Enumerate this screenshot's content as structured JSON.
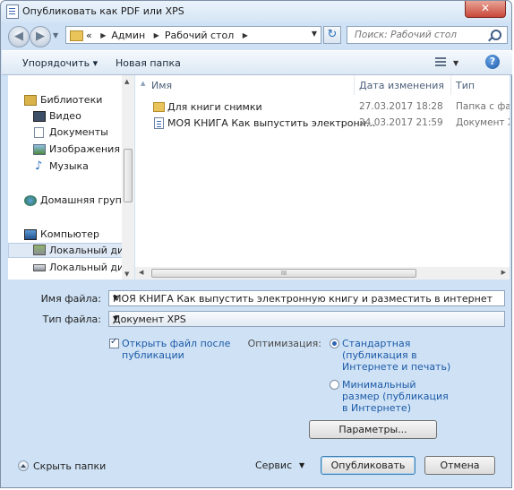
{
  "window": {
    "title": "Опубликовать как PDF или XPS",
    "close_glyph": "✕"
  },
  "address": {
    "prefix": "«",
    "crumbs": [
      "Админ",
      "Рабочий стол"
    ],
    "search_placeholder": "Поиск: Рабочий стол"
  },
  "toolbar": {
    "organize": "Упорядочить ▾",
    "new_folder": "Новая папка",
    "help": "?"
  },
  "nav": {
    "items": [
      {
        "label": "Библиотеки",
        "icon": "libraries-icon"
      },
      {
        "label": "Видео",
        "icon": "video-icon"
      },
      {
        "label": "Документы",
        "icon": "documents-icon"
      },
      {
        "label": "Изображения",
        "icon": "pictures-icon"
      },
      {
        "label": "Музыка",
        "icon": "music-icon"
      },
      {
        "label": "Домашняя группа",
        "icon": "homegroup-icon"
      },
      {
        "label": "Компьютер",
        "icon": "computer-icon"
      },
      {
        "label": "Локальный диск",
        "icon": "drive-icon"
      },
      {
        "label": "Локальный диск",
        "icon": "drive-icon"
      }
    ]
  },
  "files": {
    "columns": {
      "name": "Имя",
      "date": "Дата изменения",
      "type": "Тип"
    },
    "rows": [
      {
        "name": "Для книги снимки",
        "date": "27.03.2017 18:28",
        "type": "Папка с фай",
        "icon": "folder-icon"
      },
      {
        "name": "МОЯ КНИГА Как выпустить электронн...",
        "date": "24.03.2017 21:59",
        "type": "Документ XPS",
        "icon": "xps-document-icon"
      }
    ],
    "scroll_grip": "III"
  },
  "form": {
    "filename_label": "Имя файла:",
    "filename_value": "МОЯ КНИГА Как выпустить электронную книгу и разместить в интернет",
    "filetype_label": "Тип файла:",
    "filetype_value": "Документ XPS",
    "open_after_line1": "Открыть файл после",
    "open_after_line2": "публикации",
    "open_after_checked": true,
    "optimize_label": "Оптимизация:",
    "opt_standard": [
      "Стандартная",
      "(публикация в",
      "Интернете и печать)"
    ],
    "opt_minimal": [
      "Минимальный",
      "размер (публикация",
      "в Интернете)"
    ],
    "selected_option": "standard",
    "params_button": "Параметры..."
  },
  "footer": {
    "hide_folders": "Скрыть папки",
    "service": "Сервис",
    "publish": "Опубликовать",
    "cancel": "Отмена"
  }
}
